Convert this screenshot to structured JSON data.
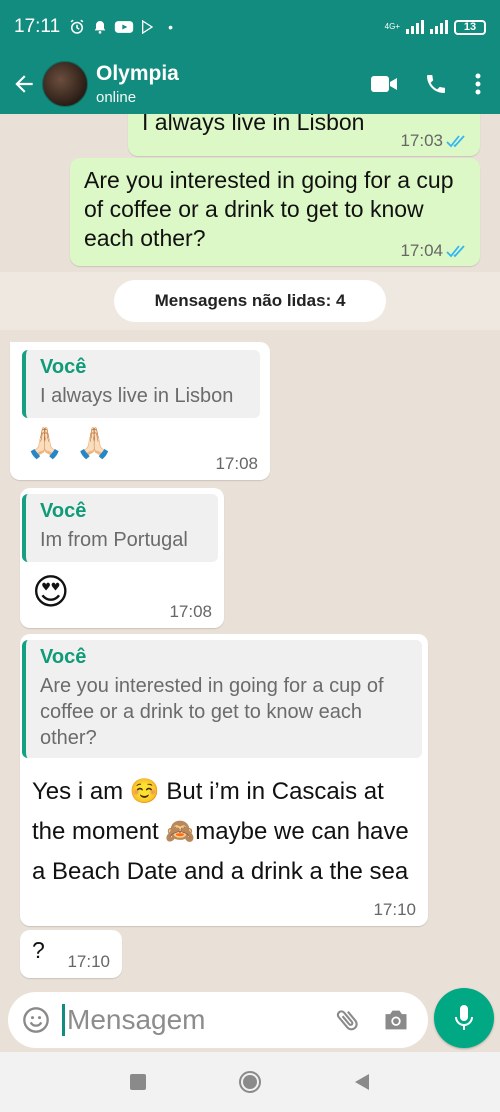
{
  "status_bar": {
    "time": "17:11",
    "network": "4G+",
    "battery": "13"
  },
  "header": {
    "name": "Olympia",
    "status": "online"
  },
  "messages": {
    "m1": {
      "text": "I always live in Lisbon",
      "time": "17:03"
    },
    "m2": {
      "text": "Are you interested in going for a cup of coffee or a drink to get to know each other?",
      "time": "17:04"
    },
    "unread": "Mensagens não lidas: 4",
    "m3": {
      "quote_author": "Você",
      "quote_text": "I always live in Lisbon",
      "text": "🙏🏻 🙏🏻",
      "time": "17:08"
    },
    "m4": {
      "quote_author": "Você",
      "quote_text": "Im from Portugal",
      "text": "😍",
      "time": "17:08"
    },
    "m5": {
      "quote_author": "Você",
      "quote_text": "Are you interested in going for a cup of coffee or a drink to get to know each other?",
      "text": "Yes i am ☺️ But i’m in Cascais at the moment 🙈maybe we can have a Beach Date and a drink a the sea",
      "time": "17:10"
    },
    "m6": {
      "text": "?",
      "time": "17:10"
    }
  },
  "composer": {
    "placeholder": "Mensagem"
  },
  "colors": {
    "header": "#128c7e",
    "outgoing": "#dcf8c6",
    "incoming": "#ffffff",
    "accent": "#00a884",
    "quote_bar": "#15a082"
  },
  "icons": [
    "back-arrow-icon",
    "video-call-icon",
    "phone-icon",
    "more-vert-icon",
    "emoji-icon",
    "attach-icon",
    "camera-icon",
    "mic-icon",
    "read-ticks-icon",
    "nav-square-icon",
    "nav-circle-icon",
    "nav-back-icon"
  ]
}
